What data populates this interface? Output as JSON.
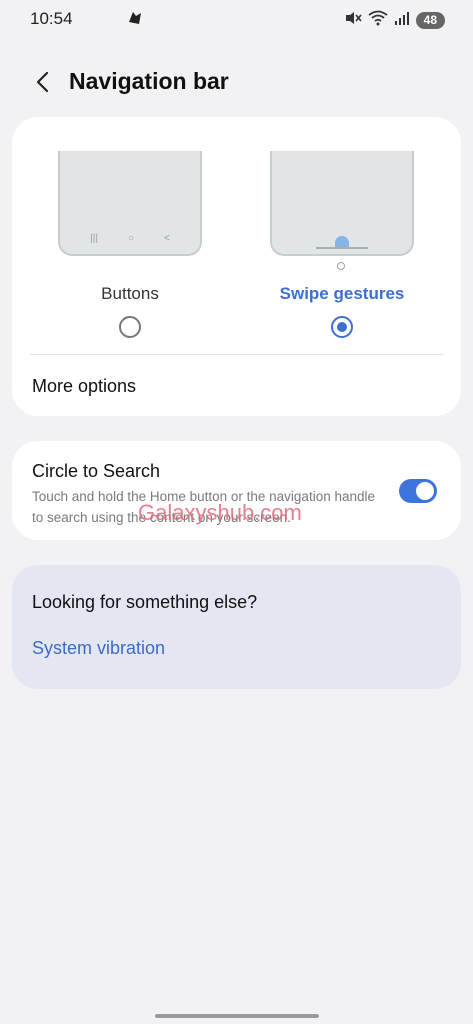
{
  "status_bar": {
    "time": "10:54",
    "battery": "48",
    "icons": [
      "notification-app-icon",
      "mute-icon",
      "wifi-icon",
      "signal-icon"
    ]
  },
  "header": {
    "title": "Navigation bar",
    "back_icon": "chevron-left-icon"
  },
  "navigation_type": {
    "options": [
      {
        "label": "Buttons",
        "selected": false
      },
      {
        "label": "Swipe gestures",
        "selected": true
      }
    ],
    "more_options": "More options"
  },
  "circle_to_search": {
    "title": "Circle to Search",
    "description": "Touch and hold the Home button or the navigation handle to search using the content on your screen.",
    "enabled": true
  },
  "looking": {
    "title": "Looking for something else?",
    "link": "System vibration"
  },
  "watermark": "Galaxyshub.com",
  "colors": {
    "accent": "#3e6fd0",
    "background": "#f2f2f4",
    "card": "#ffffff",
    "suggestion_card": "#e4e7f2"
  }
}
